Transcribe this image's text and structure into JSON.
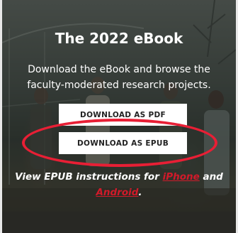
{
  "hero": {
    "title": "The 2022 eBook",
    "description": "Download the eBook and browse the faculty-moderated research projects."
  },
  "buttons": {
    "pdf_label": "DOWNLOAD AS PDF",
    "epub_label": "DOWNLOAD AS EPUB"
  },
  "instructions": {
    "prefix": "View EPUB instructions for ",
    "iphone_link": "iPhone",
    "middle": " and ",
    "android_link": "Android",
    "suffix": "."
  },
  "colors": {
    "highlight": "#e81f35",
    "link": "#d11a2a",
    "button_bg": "#ffffff"
  }
}
